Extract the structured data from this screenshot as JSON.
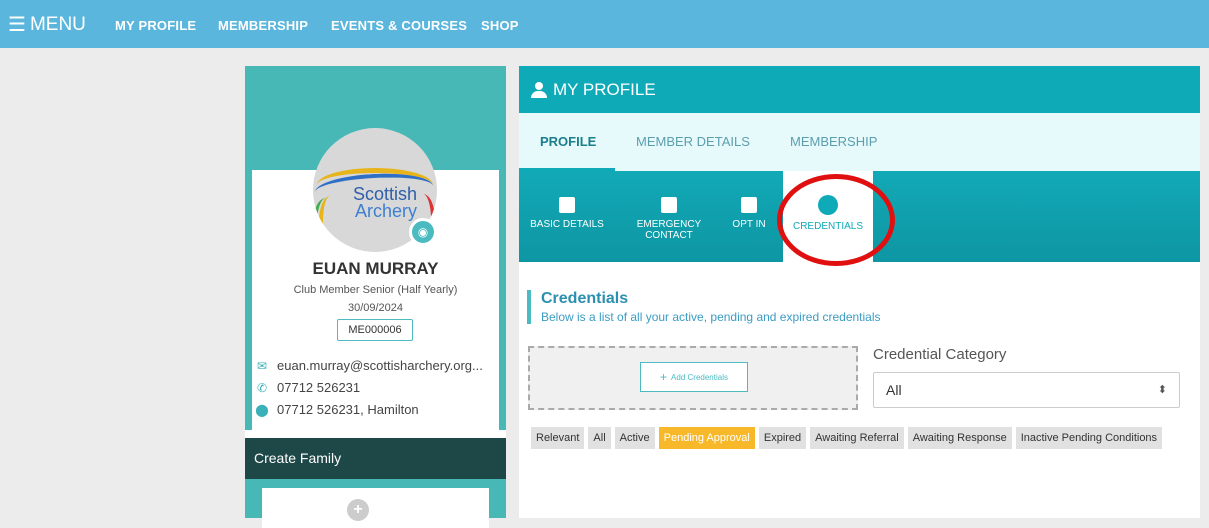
{
  "topbar": {
    "menu_label": "MENU",
    "nav": [
      "MY PROFILE",
      "MEMBERSHIP",
      "EVENTS & COURSES",
      "SHOP"
    ]
  },
  "profile": {
    "logo_line1": "Scottish",
    "logo_line2": "Archery",
    "name": "EUAN MURRAY",
    "membership_type": "Club Member Senior (Half Yearly)",
    "membership_date": "30/09/2024",
    "member_id": "ME000006",
    "email": "euan.murray@scottisharchery.org...",
    "phone": "07712 526231",
    "address": "07712 526231, Hamilton",
    "create_family_label": "Create Family"
  },
  "main": {
    "header_title": "MY PROFILE",
    "tabs": [
      "PROFILE",
      "MEMBER DETAILS",
      "MEMBERSHIP"
    ],
    "active_tab": "PROFILE",
    "subtabs": [
      {
        "line1": "BASIC DETAILS",
        "line2": ""
      },
      {
        "line1": "EMERGENCY",
        "line2": "CONTACT"
      },
      {
        "line1": "OPT IN",
        "line2": ""
      },
      {
        "line1": "CREDENTIALS",
        "line2": ""
      }
    ],
    "credentials": {
      "title": "Credentials",
      "subtitle": "Below is a list of all your active, pending and expired credentials",
      "add_label": "Add Credentials",
      "category_label": "Credential Category",
      "category_value": "All",
      "filters": [
        "Relevant",
        "All",
        "Active",
        "Pending Approval",
        "Expired",
        "Awaiting Referral",
        "Awaiting Response",
        "Inactive Pending Conditions"
      ],
      "active_filter": "Pending Approval"
    }
  },
  "colors": {
    "topbar": "#5bb6dd",
    "teal": "#0faab8",
    "dark_teal": "#1e4747",
    "highlight": "#f7b829",
    "annotation_red": "#e01010"
  }
}
